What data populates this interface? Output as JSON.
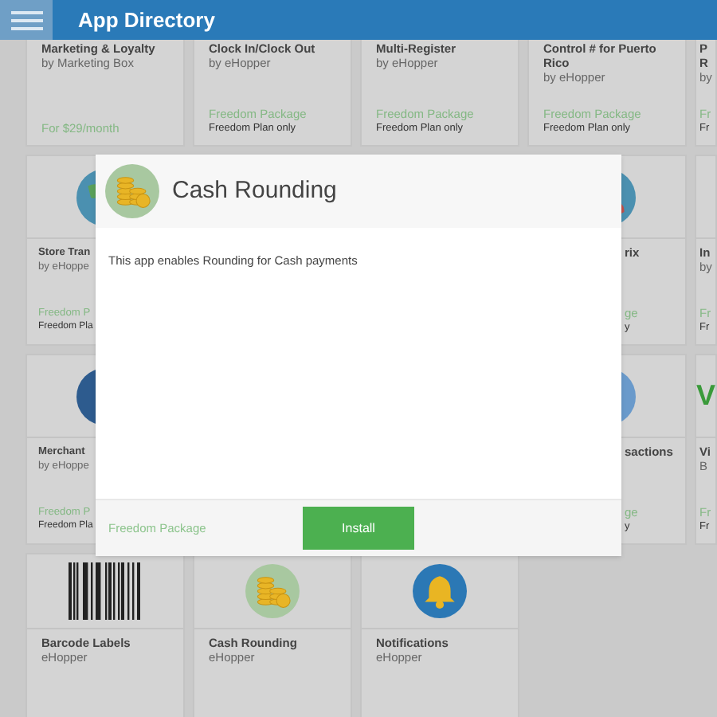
{
  "header": {
    "title": "App Directory"
  },
  "rows": [
    {
      "kind": "top",
      "cards": [
        {
          "title": "Marketing & Loyalty",
          "byline": "by Marketing Box",
          "price": "For $29/month"
        },
        {
          "title": "Clock In/Clock Out",
          "byline": "by eHopper",
          "package": "Freedom Package",
          "plan": "Freedom Plan only"
        },
        {
          "title": "Multi-Register",
          "byline": "by eHopper",
          "package": "Freedom Package",
          "plan": "Freedom Plan only"
        },
        {
          "title": "Control # for Puerto Rico",
          "byline": "by eHopper",
          "package": "Freedom Package",
          "plan": "Freedom Plan only"
        },
        {
          "title": "P R",
          "byline": "by",
          "package": "Fr",
          "plan": "Fr"
        }
      ]
    },
    {
      "kind": "full",
      "cards": [
        {
          "title": "Store Tran",
          "byline": "by eHoppe",
          "package": "Freedom P",
          "plan": "Freedom Pla"
        },
        {
          "title": "rix",
          "package": "ge",
          "plan": "y"
        },
        {
          "title": "In",
          "byline": "by",
          "package": "Fr",
          "plan": "Fr"
        }
      ]
    },
    {
      "kind": "full",
      "cards": [
        {
          "title": "Merchant",
          "byline": "by eHoppe",
          "package": "Freedom P",
          "plan": "Freedom Pla"
        },
        {
          "title": "sactions",
          "package": "ge",
          "plan": "y"
        },
        {
          "logo": "V",
          "title": "Vi",
          "byline": "B",
          "package": "Fr",
          "plan": "Fr"
        }
      ]
    },
    {
      "kind": "bottom",
      "cards": [
        {
          "title": "Barcode Labels",
          "byline": "eHopper"
        },
        {
          "title": "Cash Rounding",
          "byline": "eHopper"
        },
        {
          "title": "Notifications",
          "byline": "eHopper"
        }
      ]
    }
  ],
  "modal": {
    "title": "Cash Rounding",
    "description": "This app enables Rounding for Cash payments",
    "package": "Freedom Package",
    "install_button": "Install"
  }
}
